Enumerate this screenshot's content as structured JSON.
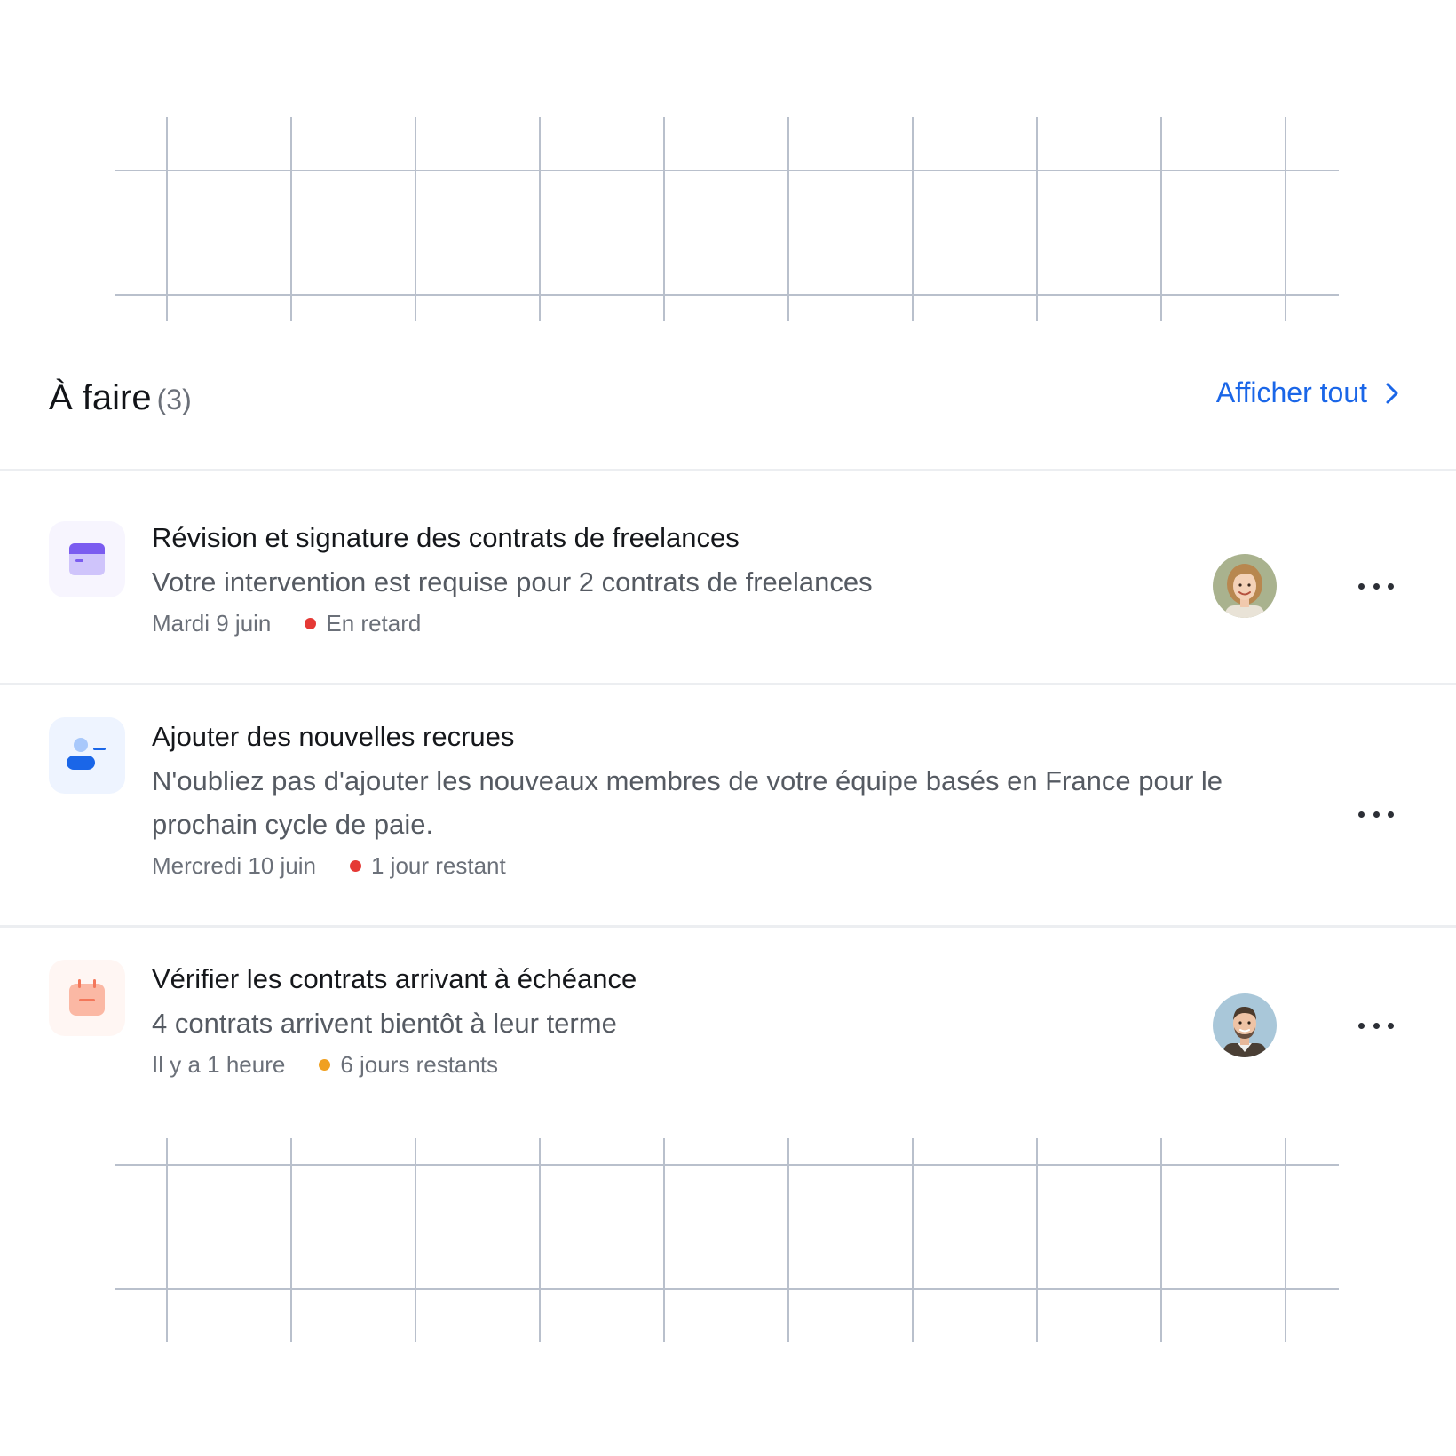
{
  "header": {
    "title": "À faire",
    "count": "(3)",
    "see_all_label": "Afficher tout"
  },
  "tasks": [
    {
      "title": "Révision et signature des contrats de freelances",
      "description": "Votre intervention est requise pour 2 contrats de freelances",
      "date": "Mardi 9 juin",
      "status": "En retard",
      "status_color": "#e53935",
      "icon": "document-card-icon",
      "icon_color": "#7b5cf0",
      "has_avatar": true,
      "avatar": "woman-avatar"
    },
    {
      "title": "Ajouter des nouvelles recrues",
      "description": "N'oubliez pas d'ajouter les nouveaux membres de votre équipe basés en France pour le prochain cycle de paie.",
      "date": "Mercredi 10 juin",
      "status": "1 jour restant",
      "status_color": "#e53935",
      "icon": "user-remove-icon",
      "icon_color": "#1a66e8",
      "has_avatar": false
    },
    {
      "title": "Vérifier les contrats arrivant à échéance",
      "description": "4 contrats arrivent bientôt à leur terme",
      "date": "Il y a 1 heure",
      "status": "6 jours restants",
      "status_color": "#f0a020",
      "icon": "calendar-icon",
      "icon_color": "#f3775a",
      "has_avatar": true,
      "avatar": "man-avatar"
    }
  ],
  "colors": {
    "accent": "#1a66e8",
    "grid_line": "#b9c0cc",
    "divider": "#eceef1"
  }
}
